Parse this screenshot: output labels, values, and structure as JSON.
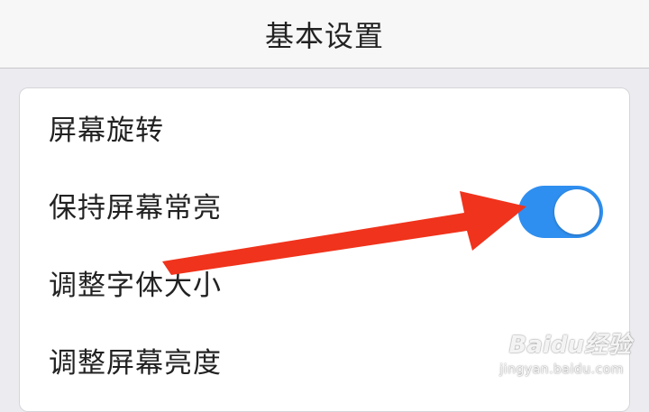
{
  "header": {
    "title": "基本设置"
  },
  "settings": {
    "items": [
      {
        "label": "屏幕旋转"
      },
      {
        "label": "保持屏幕常亮",
        "toggle_on": true
      },
      {
        "label": "调整字体大小"
      },
      {
        "label": "调整屏幕亮度"
      }
    ]
  },
  "colors": {
    "toggle_on": "#2f8ff0",
    "annotation_arrow": "#f0331c",
    "background": "#ececf0"
  },
  "watermark": {
    "brand": "Baidu经验",
    "url": "jingyan.baidu.com"
  },
  "icons": [
    "paw-icon"
  ]
}
